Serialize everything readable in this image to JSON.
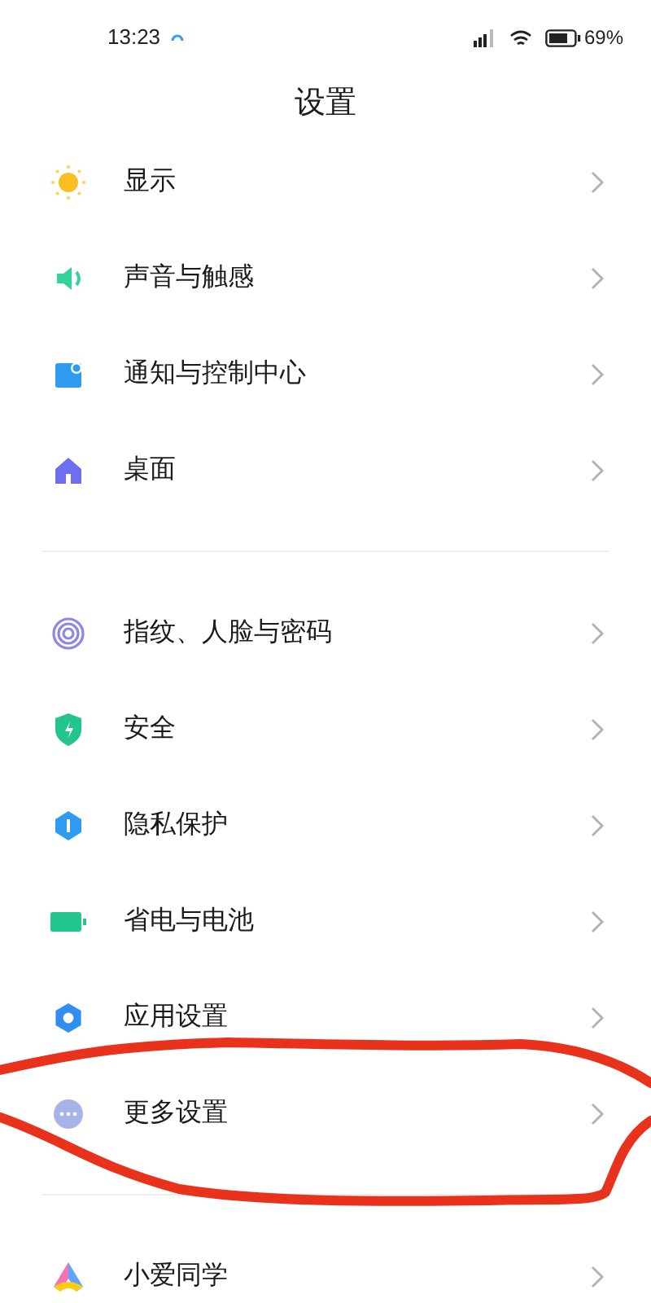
{
  "status_bar": {
    "time": "13:23",
    "battery": "69%"
  },
  "title": "设置",
  "groups": [
    {
      "items": [
        {
          "kind": "sun",
          "label": "显示"
        },
        {
          "kind": "speaker",
          "label": "声音与触感"
        },
        {
          "kind": "notification",
          "label": "通知与控制中心"
        },
        {
          "kind": "home",
          "label": "桌面"
        }
      ]
    },
    {
      "items": [
        {
          "kind": "fingerprint",
          "label": "指纹、人脸与密码"
        },
        {
          "kind": "shield",
          "label": "安全"
        },
        {
          "kind": "privacy",
          "label": "隐私保护"
        },
        {
          "kind": "battery",
          "label": "省电与电池"
        },
        {
          "kind": "gear",
          "label": "应用设置"
        },
        {
          "kind": "more",
          "label": "更多设置"
        }
      ]
    },
    {
      "items": [
        {
          "kind": "assistant",
          "label": "小爱同学"
        }
      ]
    }
  ]
}
